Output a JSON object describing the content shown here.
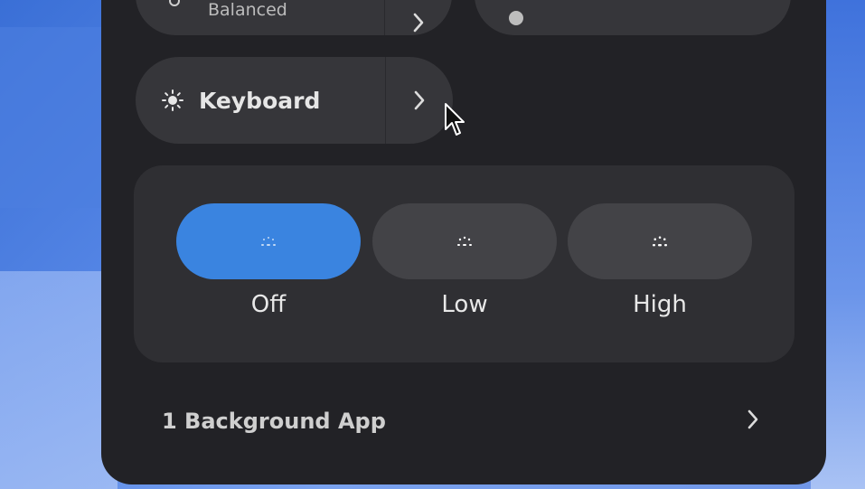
{
  "colors": {
    "panel_bg": "#222226",
    "pill_bg": "#36363a",
    "card_bg": "#2f2f33",
    "accent": "#3a84e0"
  },
  "power_mode": {
    "subtitle": "Balanced",
    "icon": "power-mode-icon",
    "arrow_icon": "chevron-right-icon"
  },
  "keyboard": {
    "label": "Keyboard",
    "icon": "keyboard-brightness-icon",
    "arrow_icon": "chevron-right-icon"
  },
  "backlight": {
    "selected": "Off",
    "levels": [
      {
        "label": "Off",
        "icon": "backlight-off-icon",
        "active": true
      },
      {
        "label": "Low",
        "icon": "backlight-low-icon",
        "active": false
      },
      {
        "label": "High",
        "icon": "backlight-high-icon",
        "active": false
      }
    ]
  },
  "background_apps": {
    "label": "1 Background App",
    "arrow_icon": "chevron-right-icon"
  }
}
